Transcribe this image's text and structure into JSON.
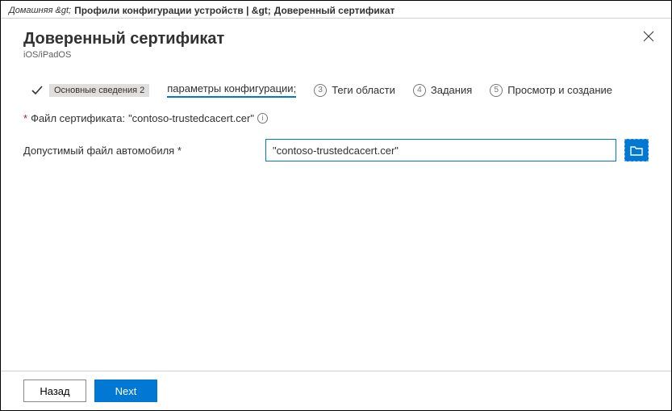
{
  "breadcrumb": {
    "home": "Домашняя &gt;",
    "profiles": "Профили конфигурации устройств | &gt;",
    "current": "Доверенный сертификат"
  },
  "header": {
    "title": "Доверенный сертификат",
    "subtitle": "iOS/iPadOS"
  },
  "stepper": {
    "step1": "Основные сведения 2",
    "step2": "параметры конфигурации;",
    "step3_num": "3",
    "step3": "Теги области",
    "step4_num": "4",
    "step4": "Задания",
    "step5_num": "5",
    "step5": "Просмотр и создание"
  },
  "form": {
    "required_mark": "*",
    "cert_label_prefix": "Файл сертификата: ",
    "cert_name": "\"contoso-trustedcacert.cer\"",
    "field_label": "Допустимый файл автомобиля *",
    "field_value": "\"contoso-trustedcacert.cer\""
  },
  "footer": {
    "back": "Назад",
    "next": "Next"
  },
  "icons": {
    "info": "i"
  }
}
